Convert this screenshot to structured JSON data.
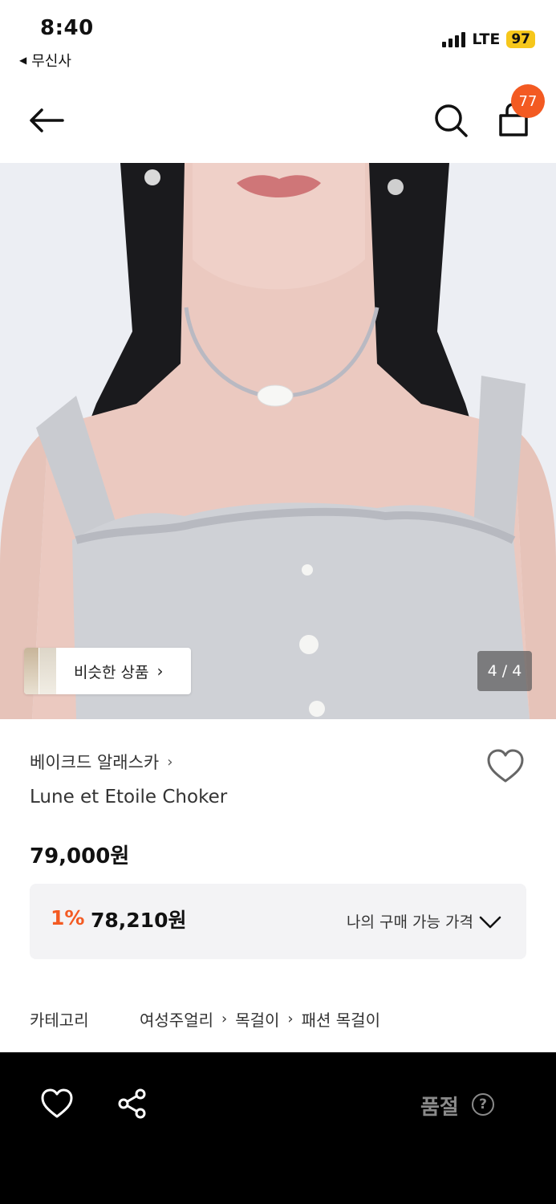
{
  "status_bar": {
    "time": "8:40",
    "back_app": "무신사",
    "network": "LTE",
    "battery": "97"
  },
  "header": {
    "back_icon": "arrow-left-icon",
    "search_icon": "search-icon",
    "cart_icon": "shopping-bag-icon",
    "cart_badge": "77",
    "badge_color": "#f35a22"
  },
  "gallery": {
    "similar_label": "비슷한 상품",
    "similar_chevron": "›",
    "page_counter": "4 / 4"
  },
  "product": {
    "brand": "베이크드 알래스카",
    "brand_chevron": "›",
    "name": "Lune et Etoile Choker",
    "price": "79,000원"
  },
  "member_price": {
    "discount_percent": "1%",
    "discount_price": "78,210원",
    "label": "나의 구매 가능 가격",
    "accent_color": "#f35a22"
  },
  "category": {
    "label": "카테고리",
    "path": [
      "여성주얼리",
      "목걸이",
      "패션 목걸이"
    ],
    "separator": "›"
  },
  "bottom_bar": {
    "like_icon": "heart-icon",
    "share_icon": "share-icon",
    "soldout_label": "품절",
    "help_glyph": "?"
  }
}
